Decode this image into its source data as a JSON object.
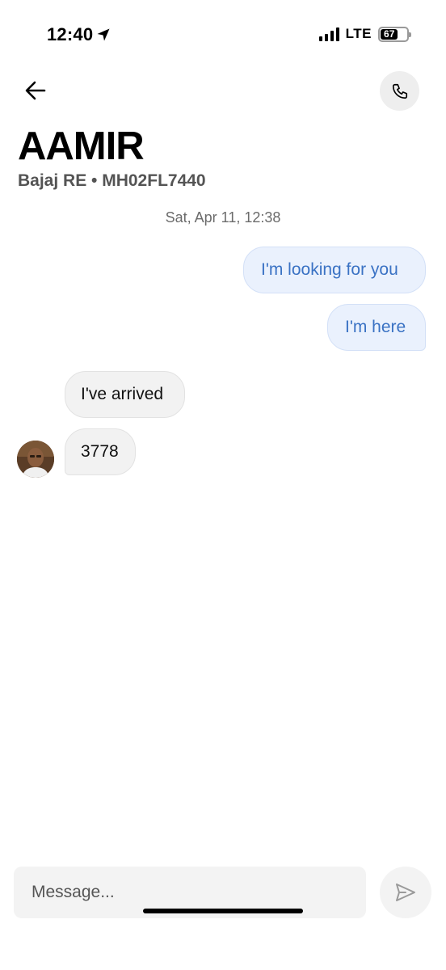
{
  "status_bar": {
    "time": "12:40",
    "network": "LTE",
    "battery_level": "67"
  },
  "header": {
    "contact_name": "AAMIR",
    "vehicle_info": "Bajaj RE • MH02FL7440"
  },
  "conversation": {
    "timestamp": "Sat, Apr 11, 12:38",
    "messages": [
      {
        "direction": "sent",
        "text": "I'm looking for you"
      },
      {
        "direction": "sent",
        "text": "I'm here"
      },
      {
        "direction": "received",
        "text": "I've arrived"
      },
      {
        "direction": "received",
        "text": "3778"
      }
    ]
  },
  "composer": {
    "placeholder": "Message..."
  },
  "icons": {
    "back": "arrow-left-icon",
    "call": "phone-icon",
    "send": "send-icon",
    "location": "location-arrow-icon"
  },
  "colors": {
    "sent_bubble_bg": "#eaf1fd",
    "sent_text": "#3a72c4",
    "received_bubble_bg": "#f2f2f2"
  }
}
